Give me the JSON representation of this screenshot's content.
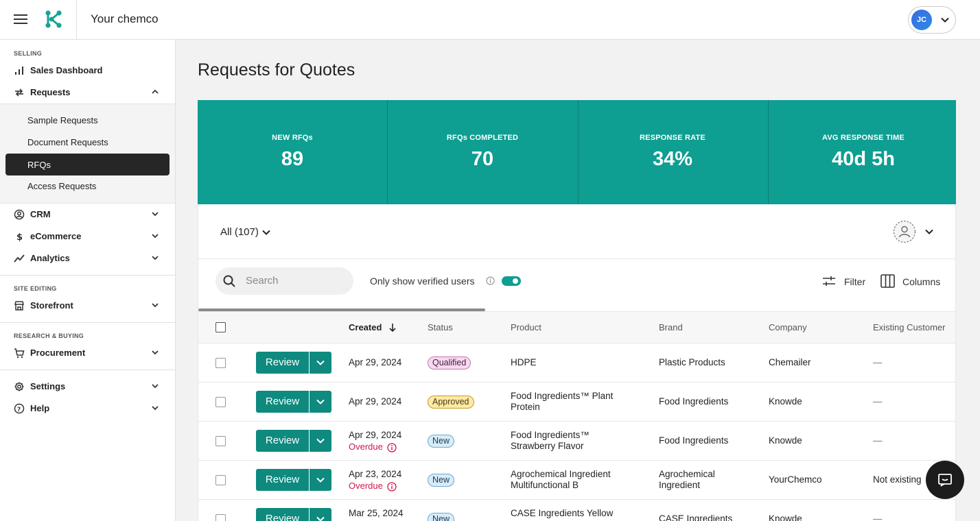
{
  "app": {
    "title": "Your chemco",
    "user_initials": "JC"
  },
  "sidebar": {
    "sections": {
      "selling": "SELLING",
      "site_editing": "SITE EDITING",
      "research_buying": "RESEARCH & BUYING"
    },
    "items": {
      "sales_dashboard": "Sales Dashboard",
      "requests": "Requests",
      "sample_requests": "Sample Requests",
      "document_requests": "Document Requests",
      "rfqs": "RFQs",
      "access_requests": "Access Requests",
      "crm": "CRM",
      "ecommerce": "eCommerce",
      "analytics": "Analytics",
      "storefront": "Storefront",
      "procurement": "Procurement",
      "settings": "Settings",
      "help": "Help"
    },
    "active_item": "RFQs"
  },
  "page": {
    "title": "Requests for Quotes"
  },
  "stats": [
    {
      "label": "NEW RFQs",
      "value": "89"
    },
    {
      "label": "RFQs COMPLETED",
      "value": "70"
    },
    {
      "label": "RESPONSE RATE",
      "value": "34%"
    },
    {
      "label": "AVG RESPONSE TIME",
      "value": "40d 5h"
    }
  ],
  "toolbar": {
    "filter_all": "All (107)",
    "search_placeholder": "Search",
    "verified_label": "Only show verified users",
    "verified_on": true,
    "filter_label": "Filter",
    "columns_label": "Columns"
  },
  "table": {
    "headers": {
      "created": "Created",
      "status": "Status",
      "product": "Product",
      "brand": "Brand",
      "company": "Company",
      "existing_customer": "Existing Customer"
    },
    "review_label": "Review",
    "overdue_label": "Overdue",
    "rows": [
      {
        "created": "Apr 29, 2024",
        "status": "Qualified",
        "product": "HDPE",
        "brand": "Plastic Products",
        "company": "Chemailer",
        "existing": "—"
      },
      {
        "created": "Apr 29, 2024",
        "status": "Approved",
        "product": "Food Ingredients™ Plant Protein",
        "brand": "Food Ingredients",
        "company": "Knowde",
        "existing": "—"
      },
      {
        "created": "Apr 29, 2024",
        "overdue": true,
        "status": "New",
        "product": "Food Ingredients™ Strawberry Flavor",
        "brand": "Food Ingredients",
        "company": "Knowde",
        "existing": "—"
      },
      {
        "created": "Apr 23, 2024",
        "overdue": true,
        "status": "New",
        "product": "Agrochemical Ingredient Multifunctional B",
        "brand": "Agrochemical Ingredient",
        "company": "YourChemco",
        "existing": "Not existing"
      },
      {
        "created": "Mar 25, 2024",
        "status": "New",
        "product": "CASE Ingredients Yellow",
        "brand": "CASE Ingredients",
        "company": "Knowde",
        "existing": "—"
      }
    ]
  },
  "colors": {
    "brand_teal": "#0e9e92",
    "review_button": "#0e8a7f",
    "overdue_red": "#d0174b",
    "active_nav": "#262626"
  }
}
